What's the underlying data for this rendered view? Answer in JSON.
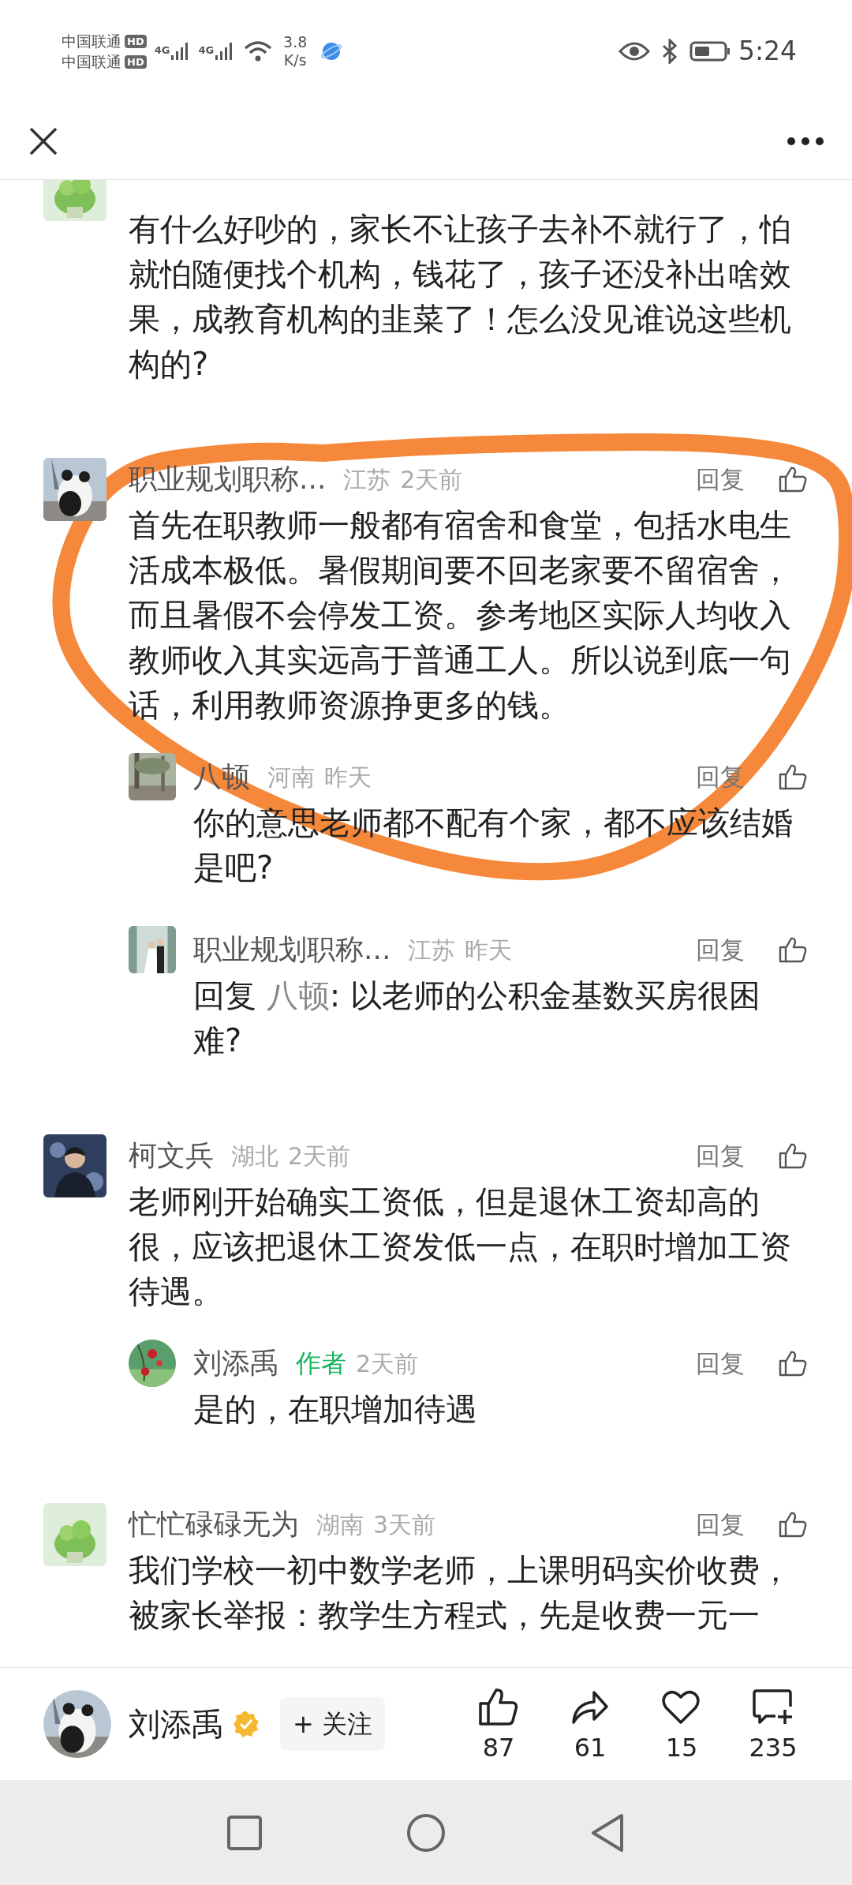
{
  "status_bar": {
    "carriers": [
      {
        "name": "中国联通",
        "badge": "HD"
      },
      {
        "name": "中国联通",
        "badge": "HD"
      }
    ],
    "network_labels": [
      "4G",
      "4G"
    ],
    "speed_value": "3.8",
    "speed_unit": "K/s",
    "time": "5:24"
  },
  "comments": [
    {
      "body": "有什么好吵的，家长不让孩子去补不就行了，怕就怕随便找个机构，钱花了，孩子还没补出啥效果，成教育机构的韭菜了！怎么没见谁说这些机构的?"
    },
    {
      "name": "职业规划职称...",
      "location": "江苏",
      "time": "2天前",
      "reply_label": "回复",
      "body": "首先在职教师一般都有宿舍和食堂，包括水电生活成本极低。暑假期间要不回老家要不留宿舍，而且暑假不会停发工资。参考地区实际人均收入教师收入其实远高于普通工人。所以说到底一句话，利用教师资源挣更多的钱。",
      "children": [
        {
          "name": "八顿",
          "location": "河南",
          "time": "昨天",
          "reply_label": "回复",
          "body": "你的意思老师都不配有个家，都不应该结婚是吧?"
        },
        {
          "name": "职业规划职称...",
          "location": "江苏",
          "time": "昨天",
          "reply_label": "回复",
          "reply_prefix": "回复",
          "mention": "八顿",
          "body": ": 以老师的公积金基数买房很困难?"
        }
      ]
    },
    {
      "name": "柯文兵",
      "location": "湖北",
      "time": "2天前",
      "reply_label": "回复",
      "body": "老师刚开始确实工资低，但是退休工资却高的很，应该把退休工资发低一点，在职时增加工资待遇。",
      "children": [
        {
          "name": "刘添禹",
          "author_badge": "作者",
          "time": "2天前",
          "reply_label": "回复",
          "body": "是的，在职增加待遇"
        }
      ]
    },
    {
      "name": "忙忙碌碌无为",
      "location": "湖南",
      "time": "3天前",
      "reply_label": "回复",
      "body": "我们学校一初中数学老师，上课明码实价收费，被家长举报：教学生方程式，先是收费一元一"
    }
  ],
  "bottom_bar": {
    "author": "刘添禹",
    "verified": true,
    "follow_button": "+ 关注",
    "actions": [
      {
        "kind": "like",
        "count": "87"
      },
      {
        "kind": "share",
        "count": "61"
      },
      {
        "kind": "favorite",
        "count": "15"
      },
      {
        "kind": "comment",
        "count": "235"
      }
    ]
  }
}
